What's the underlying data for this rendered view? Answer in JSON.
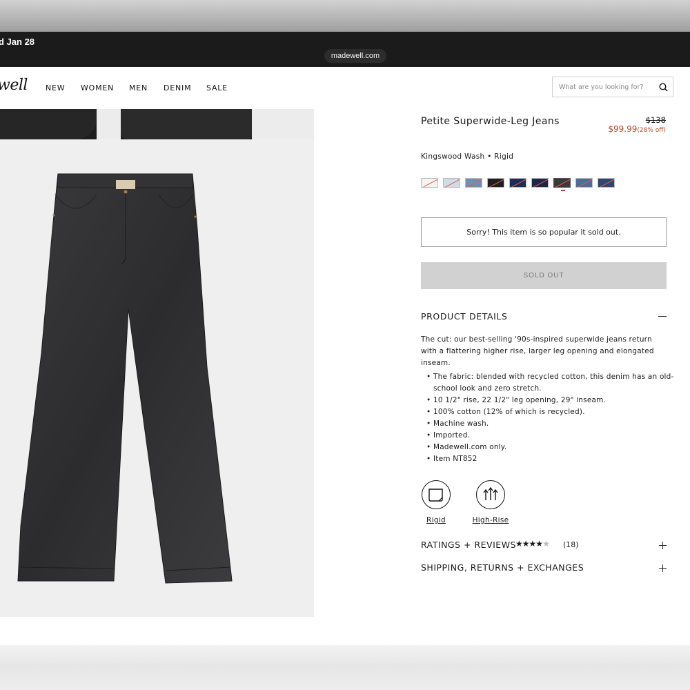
{
  "statusbar": {
    "date": "d Jan 28",
    "url": "madewell.com"
  },
  "header": {
    "logo": "well",
    "nav": [
      "NEW",
      "WOMEN",
      "MEN",
      "DENIM",
      "SALE"
    ],
    "search_placeholder": "What are you looking for?"
  },
  "product": {
    "title": "Petite Superwide-Leg Jeans",
    "original_price": "$138",
    "sale_price": "$99.99",
    "discount": "(28% off)",
    "color_label": "Kingswood Wash • Rigid",
    "swatch_colors": [
      "#f4f4f4",
      "#cfdbe6",
      "#6f8fb5",
      "#1f1f22",
      "#1e2c55",
      "#1c2748",
      "#3a3a3a",
      "#4a6d9a",
      "#2f4670"
    ],
    "selected_swatch": 6,
    "sold_out_message": "Sorry! This item is so popular it sold out.",
    "sold_out_button": "SOLD OUT"
  },
  "details": {
    "heading": "PRODUCT DETAILS",
    "description": "The cut: our best-selling '90s-inspired superwide jeans return with a flattering higher rise, larger leg opening and elongated inseam.",
    "bullets": [
      "The fabric: blended with recycled cotton, this denim has an old-school look and zero stretch.",
      "10 1/2\" rise, 22 1/2\" leg opening, 29\" inseam.",
      "100% cotton (12% of which is recycled).",
      "Machine wash.",
      "Imported.",
      "Madewell.com only.",
      "Item NT852"
    ],
    "features": [
      {
        "label": "Rigid",
        "icon": "rigid-fabric-icon"
      },
      {
        "label": "High-Rise",
        "icon": "high-rise-icon"
      }
    ]
  },
  "accordions": {
    "ratings": "RATINGS + REVIEWS",
    "rating_stars": 4,
    "rating_count": "(18)",
    "shipping": "SHIPPING, RETURNS + EXCHANGES"
  }
}
